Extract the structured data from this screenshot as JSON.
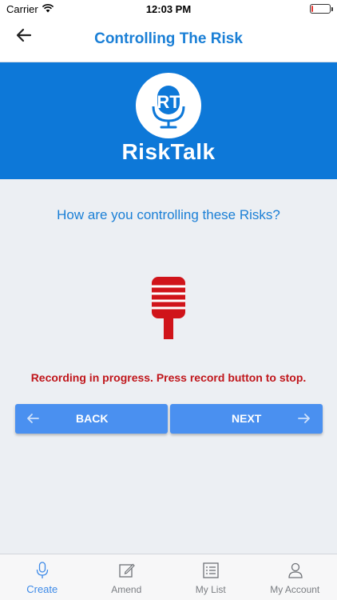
{
  "status_bar": {
    "carrier": "Carrier",
    "time": "12:03 PM",
    "battery_level": 0.1,
    "battery_color": "#e3342f"
  },
  "nav": {
    "title": "Controlling The Risk",
    "back_icon": "back-arrow-icon"
  },
  "banner": {
    "logo_text": "RiskTalk",
    "background_color": "#0d78d8"
  },
  "question": "How are you controlling these Risks?",
  "recorder": {
    "icon": "microphone-icon",
    "color": "#d0141a",
    "status_text": "Recording in progress. Press record button to stop."
  },
  "buttons": {
    "back_label": "BACK",
    "next_label": "NEXT",
    "color": "#4a90f0"
  },
  "tabs": [
    {
      "label": "Create",
      "icon": "microphone-icon",
      "active": true
    },
    {
      "label": "Amend",
      "icon": "edit-icon",
      "active": false
    },
    {
      "label": "My List",
      "icon": "list-icon",
      "active": false
    },
    {
      "label": "My Account",
      "icon": "person-icon",
      "active": false
    }
  ],
  "colors": {
    "accent": "#1a7fd6",
    "tab_active": "#3d8ae8",
    "tab_inactive": "#7a7d82"
  }
}
